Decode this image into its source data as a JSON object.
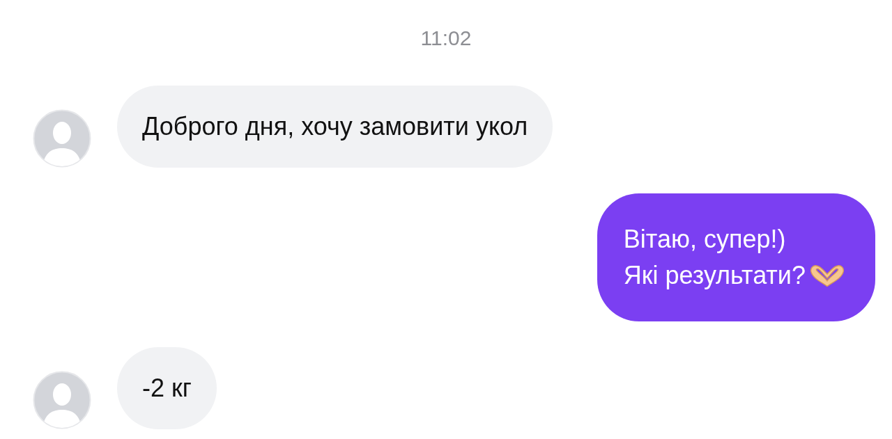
{
  "timestamp": "11:02",
  "messages": [
    {
      "kind": "incoming",
      "lines": [
        "Доброго дня, хочу замовити укол"
      ]
    },
    {
      "kind": "outgoing",
      "lines": [
        "Вітаю, супер!)",
        "Які результати?"
      ]
    },
    {
      "kind": "incoming",
      "lines": [
        "-2 кг"
      ]
    }
  ]
}
